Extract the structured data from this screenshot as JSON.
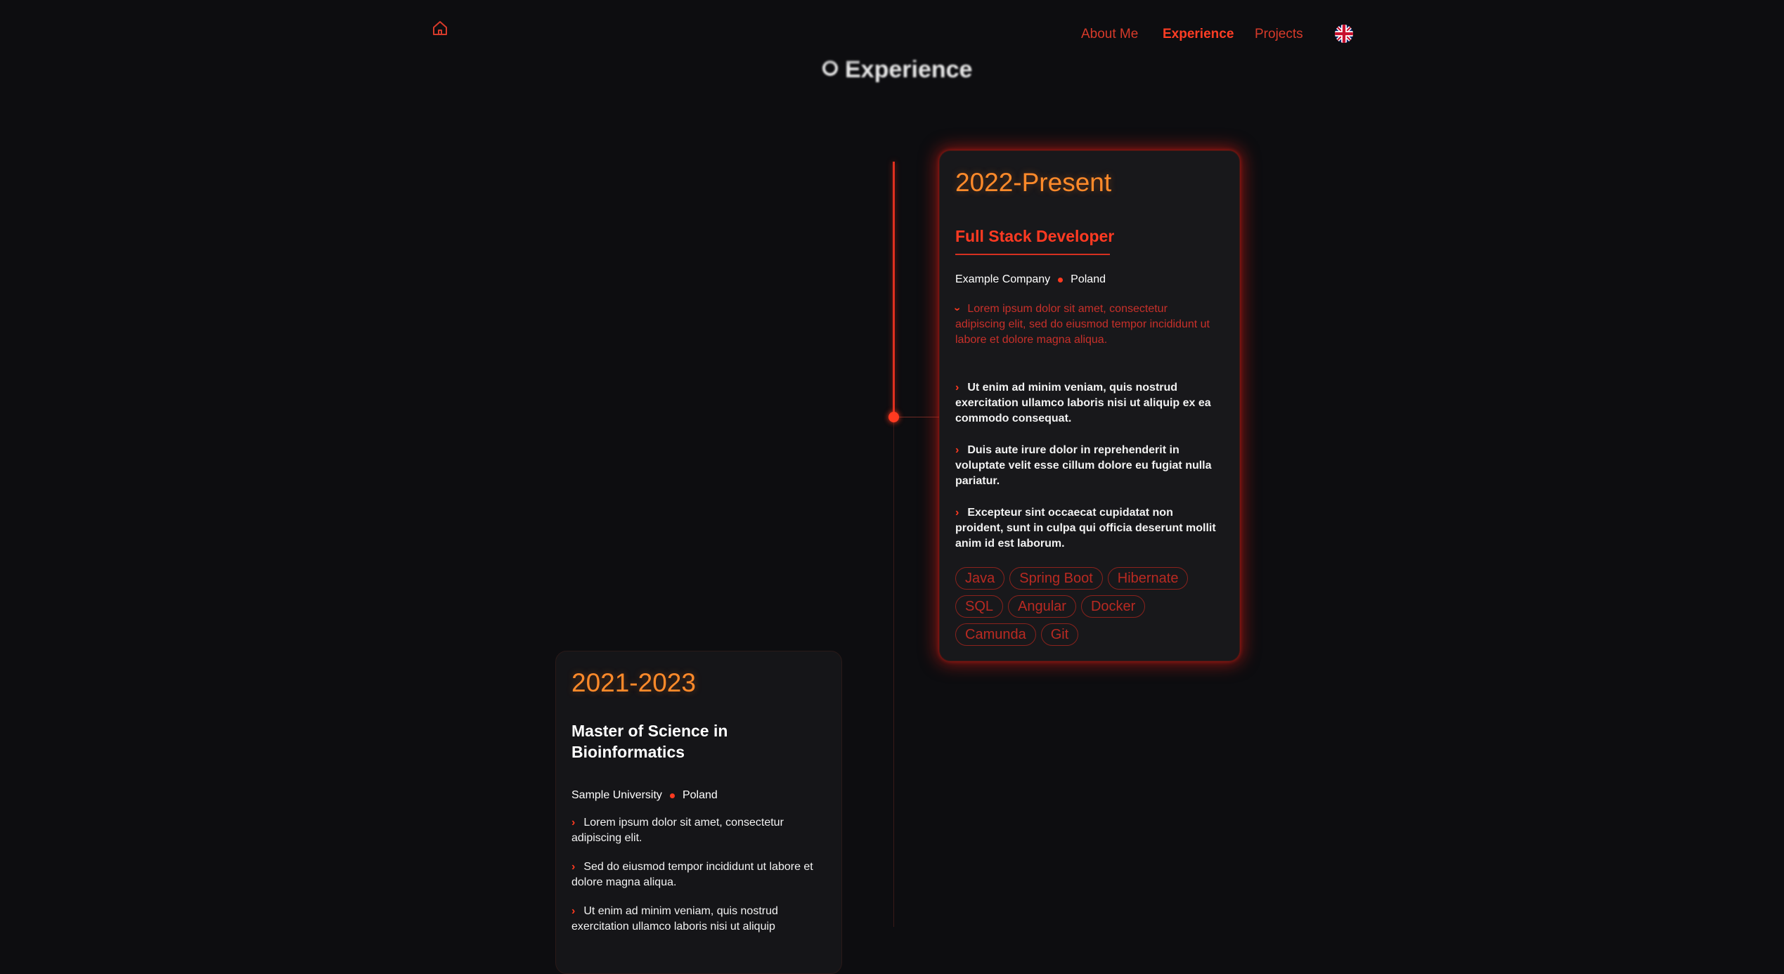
{
  "nav": {
    "items": [
      {
        "label": "About Me",
        "active": false
      },
      {
        "label": "Experience",
        "active": true
      },
      {
        "label": "Projects",
        "active": false
      }
    ],
    "home_icon": "home-icon",
    "language_icon": "uk-flag-icon"
  },
  "section": {
    "title": "Experience",
    "title_icon": "bullet-icon"
  },
  "experience": {
    "period": "2022-Present",
    "role": "Full Stack Developer",
    "company": "Example Company",
    "location": "Poland",
    "bullets": [
      "Lorem ipsum dolor sit amet, consectetur adipiscing elit, sed do eiusmod tempor incididunt ut labore et dolore magna aliqua.",
      "Ut enim ad minim veniam, quis nostrud exercitation ullamco laboris nisi ut aliquip ex ea commodo consequat.",
      "Duis aute irure dolor in reprehenderit in voluptate velit esse cillum dolore eu fugiat nulla pariatur.",
      "Excepteur sint occaecat cupidatat non proident, sunt in culpa qui officia deserunt mollit anim id est laborum."
    ],
    "tags": [
      "Java",
      "Spring Boot",
      "Hibernate",
      "SQL",
      "Angular",
      "Docker",
      "Camunda",
      "Git"
    ]
  },
  "education": {
    "period": "2021-2023",
    "degree": "Master of Science in Bioinformatics",
    "institution": "Sample University",
    "location": "Poland",
    "bullets": [
      "Lorem ipsum dolor sit amet, consectetur adipiscing elit.",
      "Sed do eiusmod tempor incididunt ut labore et dolore magna aliqua.",
      "Ut enim ad minim veniam, quis nostrud exercitation ullamco laboris nisi ut aliquip"
    ]
  },
  "colors": {
    "background": "#0d0d10",
    "accent": "#ff3a20",
    "period": "#ff8a2a"
  }
}
